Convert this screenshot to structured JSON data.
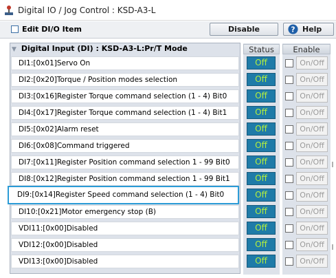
{
  "window": {
    "title": "Digital IO / Jog Control : KSD-A3-L"
  },
  "toolbar": {
    "edit_label": "Edit DI/O Item",
    "disable_label": "Disable",
    "help_label": "Help"
  },
  "panel": {
    "header": "Digital Input (DI) : KSD-A3-L:Pr/T Mode"
  },
  "columns": {
    "status": "Status",
    "enable": "Enable"
  },
  "rows": [
    {
      "label": "DI1:[0x01]Servo On",
      "status": "Off",
      "enable": "On/Off"
    },
    {
      "label": "DI2:[0x20]Torque / Position modes selection",
      "status": "Off",
      "enable": "On/Off"
    },
    {
      "label": "DI3:[0x16]Register Torque command selection (1 - 4) Bit0",
      "status": "Off",
      "enable": "On/Off"
    },
    {
      "label": "DI4:[0x17]Register Torque command selection (1 - 4) Bit1",
      "status": "Off",
      "enable": "On/Off"
    },
    {
      "label": "DI5:[0x02]Alarm reset",
      "status": "Off",
      "enable": "On/Off"
    },
    {
      "label": "DI6:[0x08]Command triggered",
      "status": "Off",
      "enable": "On/Off"
    },
    {
      "label": "DI7:[0x11]Register Position command selection 1 - 99 Bit0",
      "status": "Off",
      "enable": "On/Off"
    },
    {
      "label": "DI8:[0x12]Register Position command selection 1 - 99 Bit1",
      "status": "Off",
      "enable": "On/Off"
    },
    {
      "label": "DI9:[0x14]Register Speed command selection (1 - 4) Bit0",
      "status": "Off",
      "enable": "On/Off"
    },
    {
      "label": "DI10:[0x21]Motor emergency stop (B)",
      "status": "Off",
      "enable": "On/Off"
    },
    {
      "label": "VDI11:[0x00]Disabled",
      "status": "Off",
      "enable": "On/Off"
    },
    {
      "label": "VDI12:[0x00]Disabled",
      "status": "Off",
      "enable": "On/Off"
    },
    {
      "label": "VDI13:[0x00]Disabled",
      "status": "Off",
      "enable": "On/Off"
    }
  ],
  "colors": {
    "status_off_bg": "#1f7ba8",
    "status_off_text": "#b6f03c",
    "selection_border": "#2b9bd6"
  },
  "icons": {
    "app": "joystick-icon",
    "help": "question-circle-icon",
    "collapse": "collapse-arrow-icon"
  }
}
